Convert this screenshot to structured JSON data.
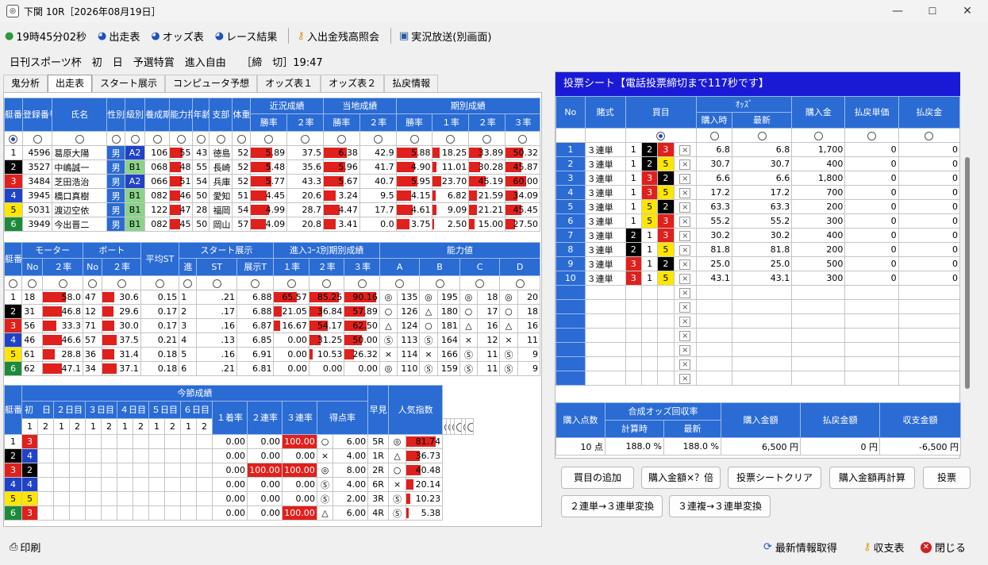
{
  "window": {
    "title": "下関 10R［2026年08月19日］"
  },
  "toolbar": {
    "clock": "19時45分02秒",
    "items": [
      "出走表",
      "オッズ表",
      "レース結果",
      "入出金残高照会",
      "実況放送(別画面)"
    ]
  },
  "race": {
    "info": "日刊スポーツ杯　初　日　予選特賞　進入自由　　［締　切］19:47"
  },
  "tabs": [
    "鬼分析",
    "出走表",
    "スタート展示",
    "コンピュータ予想",
    "オッズ表１",
    "オッズ表２",
    "払戻情報"
  ],
  "table1": {
    "headers": {
      "boat": "艇番",
      "reg": "登録番号",
      "name": "氏名",
      "gender": "性別",
      "class": "級別",
      "period": "養成期",
      "ability": "能力指数",
      "age": "年齢",
      "branch": "支部",
      "weight": "体重",
      "recent": "近況成績",
      "local": "当地成績",
      "term": "期別成績",
      "win": "勝率",
      "r2": "２率",
      "r1": "１率",
      "r3": "３率"
    },
    "rows": [
      {
        "b": "1",
        "reg": "4596",
        "name": "葛原大陽",
        "g": "男",
        "cls": "A2",
        "per": "106",
        "abl": "55",
        "age": "43",
        "br": "徳島",
        "wt": "52",
        "rw": "5.89",
        "rr2": "37.5",
        "lw": "6.38",
        "lr2": "42.9",
        "tw": "5.88",
        "tr1": "18.25",
        "tr2": "33.89",
        "tr3": "50.32"
      },
      {
        "b": "2",
        "reg": "3527",
        "name": "中嶋誠一",
        "g": "男",
        "cls": "B1",
        "per": "068",
        "abl": "48",
        "age": "55",
        "br": "長崎",
        "wt": "52",
        "rw": "5.48",
        "rr2": "35.6",
        "lw": "5.96",
        "lr2": "41.7",
        "tw": "4.90",
        "tr1": "11.01",
        "tr2": "30.28",
        "tr3": "45.87"
      },
      {
        "b": "3",
        "reg": "3484",
        "name": "芝田浩治",
        "g": "男",
        "cls": "A2",
        "per": "066",
        "abl": "51",
        "age": "54",
        "br": "兵庫",
        "wt": "52",
        "rw": "5.77",
        "rr2": "43.3",
        "lw": "5.67",
        "lr2": "40.7",
        "tw": "5.95",
        "tr1": "23.70",
        "tr2": "45.19",
        "tr3": "60.00"
      },
      {
        "b": "4",
        "reg": "3945",
        "name": "橋口真樹",
        "g": "男",
        "cls": "B1",
        "per": "082",
        "abl": "46",
        "age": "50",
        "br": "愛知",
        "wt": "51",
        "rw": "4.45",
        "rr2": "20.6",
        "lw": "3.24",
        "lr2": "9.5",
        "tw": "4.15",
        "tr1": "6.82",
        "tr2": "21.59",
        "tr3": "34.09"
      },
      {
        "b": "5",
        "reg": "5031",
        "name": "渡辺空依",
        "g": "男",
        "cls": "B1",
        "per": "122",
        "abl": "47",
        "age": "28",
        "br": "福岡",
        "wt": "54",
        "rw": "4.99",
        "rr2": "28.7",
        "lw": "4.47",
        "lr2": "17.7",
        "tw": "4.61",
        "tr1": "9.09",
        "tr2": "21.21",
        "tr3": "45.45"
      },
      {
        "b": "6",
        "reg": "3949",
        "name": "今出晋二",
        "g": "男",
        "cls": "B1",
        "per": "082",
        "abl": "45",
        "age": "50",
        "br": "岡山",
        "wt": "57",
        "rw": "4.09",
        "rr2": "20.8",
        "lw": "3.41",
        "lr2": "0.0",
        "tw": "3.75",
        "tr1": "2.50",
        "tr2": "15.00",
        "tr3": "27.50"
      }
    ]
  },
  "table2": {
    "headers": {
      "boat": "艇番",
      "motor": "モーター",
      "boatm": "ボート",
      "no": "No",
      "r2": "２率",
      "avgst": "平均ST",
      "start": "スタート展示",
      "course": "進",
      "st": "ST",
      "exh": "展示T",
      "entry": "進入ｺｰｽ別期別成績",
      "r1": "１率",
      "r3": "３率",
      "ability": "能力値",
      "A": "A",
      "B": "B",
      "C": "C",
      "D": "D"
    },
    "rows": [
      {
        "b": "1",
        "mn": "18",
        "m2": "58.0",
        "bn": "47",
        "b2": "30.6",
        "ast": "0.15",
        "c": "1",
        "st": ".21",
        "ex": "6.88",
        "e1": "65.57",
        "e2": "85.25",
        "e3": "90.16",
        "am": "◎",
        "av": "135",
        "bm": "◎",
        "bv": "195",
        "cm": "◎",
        "cv": "18",
        "dm": "◎",
        "dv": "20"
      },
      {
        "b": "2",
        "mn": "31",
        "m2": "46.8",
        "bn": "12",
        "b2": "29.6",
        "ast": "0.17",
        "c": "2",
        "st": ".17",
        "ex": "6.88",
        "e1": "21.05",
        "e2": "36.84",
        "e3": "57.89",
        "am": "○",
        "av": "126",
        "bm": "△",
        "bv": "180",
        "cm": "○",
        "cv": "17",
        "dm": "○",
        "dv": "18"
      },
      {
        "b": "3",
        "mn": "56",
        "m2": "33.3",
        "bn": "71",
        "b2": "30.0",
        "ast": "0.17",
        "c": "3",
        "st": ".16",
        "ex": "6.87",
        "e1": "16.67",
        "e2": "54.17",
        "e3": "62.50",
        "am": "△",
        "av": "124",
        "bm": "○",
        "bv": "181",
        "cm": "△",
        "cv": "16",
        "dm": "△",
        "dv": "16"
      },
      {
        "b": "4",
        "mn": "46",
        "m2": "46.6",
        "bn": "57",
        "b2": "37.5",
        "ast": "0.21",
        "c": "4",
        "st": ".13",
        "ex": "6.85",
        "e1": "0.00",
        "e2": "31.25",
        "e3": "50.00",
        "am": "Ⓢ",
        "av": "113",
        "bm": "Ⓢ",
        "bv": "164",
        "cm": "×",
        "cv": "12",
        "dm": "×",
        "dv": "11"
      },
      {
        "b": "5",
        "mn": "61",
        "m2": "28.8",
        "bn": "36",
        "b2": "31.4",
        "ast": "0.18",
        "c": "5",
        "st": ".16",
        "ex": "6.91",
        "e1": "0.00",
        "e2": "10.53",
        "e3": "26.32",
        "am": "×",
        "av": "114",
        "bm": "×",
        "bv": "166",
        "cm": "Ⓢ",
        "cv": "11",
        "dm": "Ⓢ",
        "dv": "9"
      },
      {
        "b": "6",
        "mn": "62",
        "m2": "47.1",
        "bn": "34",
        "b2": "37.1",
        "ast": "0.18",
        "c": "6",
        "st": ".21",
        "ex": "6.81",
        "e1": "0.00",
        "e2": "0.00",
        "e3": "0.00",
        "am": "◎",
        "av": "110",
        "bm": "Ⓢ",
        "bv": "159",
        "cm": "Ⓢ",
        "cv": "11",
        "dm": "Ⓢ",
        "dv": "9"
      }
    ]
  },
  "table3": {
    "headers": {
      "boat": "艇番",
      "series": "今節成績",
      "days": [
        "初　日",
        "２日目",
        "３日目",
        "４日目",
        "５日目",
        "６日目"
      ],
      "races": [
        "1",
        "2",
        "1",
        "2",
        "1",
        "2",
        "1",
        "2",
        "1",
        "2",
        "1",
        "2"
      ],
      "p1": "１着率",
      "p2": "２連率",
      "p3": "３連率",
      "score": "得点率",
      "early": "早見",
      "pop": "人気指数"
    },
    "rows": [
      {
        "b": "1",
        "d1": "3",
        "p1": "0.00",
        "p2": "0.00",
        "p3": "100.00",
        "sm": "○",
        "sc": "6.00",
        "e": "5R",
        "pm": "◎",
        "pv": "81.74"
      },
      {
        "b": "2",
        "d1": "4",
        "p1": "0.00",
        "p2": "0.00",
        "p3": "0.00",
        "sm": "×",
        "sc": "4.00",
        "e": "1R",
        "pm": "△",
        "pv": "36.73"
      },
      {
        "b": "3",
        "d1": "2",
        "p1": "0.00",
        "p2": "100.00",
        "p3": "100.00",
        "sm": "◎",
        "sc": "8.00",
        "e": "2R",
        "pm": "○",
        "pv": "40.48"
      },
      {
        "b": "4",
        "d1": "4",
        "p1": "0.00",
        "p2": "0.00",
        "p3": "0.00",
        "sm": "Ⓢ",
        "sc": "4.00",
        "e": "6R",
        "pm": "×",
        "pv": "20.14"
      },
      {
        "b": "5",
        "d1": "5",
        "p1": "0.00",
        "p2": "0.00",
        "p3": "0.00",
        "sm": "Ⓢ",
        "sc": "2.00",
        "e": "3R",
        "pm": "Ⓢ",
        "pv": "10.23"
      },
      {
        "b": "6",
        "d1": "3",
        "p1": "0.00",
        "p2": "0.00",
        "p3": "100.00",
        "sm": "△",
        "sc": "6.00",
        "e": "4R",
        "pm": "Ⓢ",
        "pv": "5.38"
      }
    ]
  },
  "vote": {
    "title": "投票シート【電話投票締切まで117秒です】",
    "headers": {
      "no": "No",
      "type": "賭式",
      "buy": "買目",
      "odds": "ｵｯｽﾞ",
      "at_buy": "購入時",
      "latest": "最新",
      "amount": "購入金",
      "pay_unit": "払戻単価",
      "payout": "払戻金"
    },
    "rows": [
      {
        "no": "1",
        "type": "３連単",
        "a": "1",
        "b": "2",
        "c": "3",
        "ob": "6.8",
        "ol": "6.8",
        "amt": "1,700",
        "pu": "0",
        "pay": "0"
      },
      {
        "no": "2",
        "type": "３連単",
        "a": "1",
        "b": "2",
        "c": "5",
        "ob": "30.7",
        "ol": "30.7",
        "amt": "400",
        "pu": "0",
        "pay": "0"
      },
      {
        "no": "3",
        "type": "３連単",
        "a": "1",
        "b": "3",
        "c": "2",
        "ob": "6.6",
        "ol": "6.6",
        "amt": "1,800",
        "pu": "0",
        "pay": "0"
      },
      {
        "no": "4",
        "type": "３連単",
        "a": "1",
        "b": "3",
        "c": "5",
        "ob": "17.2",
        "ol": "17.2",
        "amt": "700",
        "pu": "0",
        "pay": "0"
      },
      {
        "no": "5",
        "type": "３連単",
        "a": "1",
        "b": "5",
        "c": "2",
        "ob": "63.3",
        "ol": "63.3",
        "amt": "200",
        "pu": "0",
        "pay": "0"
      },
      {
        "no": "6",
        "type": "３連単",
        "a": "1",
        "b": "5",
        "c": "3",
        "ob": "55.2",
        "ol": "55.2",
        "amt": "300",
        "pu": "0",
        "pay": "0"
      },
      {
        "no": "7",
        "type": "３連単",
        "a": "2",
        "b": "1",
        "c": "3",
        "ob": "30.2",
        "ol": "30.2",
        "amt": "400",
        "pu": "0",
        "pay": "0"
      },
      {
        "no": "8",
        "type": "３連単",
        "a": "2",
        "b": "1",
        "c": "5",
        "ob": "81.8",
        "ol": "81.8",
        "amt": "200",
        "pu": "0",
        "pay": "0"
      },
      {
        "no": "9",
        "type": "３連単",
        "a": "3",
        "b": "1",
        "c": "2",
        "ob": "25.0",
        "ol": "25.0",
        "amt": "500",
        "pu": "0",
        "pay": "0"
      },
      {
        "no": "10",
        "type": "３連単",
        "a": "3",
        "b": "1",
        "c": "5",
        "ob": "43.1",
        "ol": "43.1",
        "amt": "300",
        "pu": "0",
        "pay": "0"
      }
    ],
    "x_mark": "×",
    "summary": {
      "h_points": "購入点数",
      "h_rate": "合成オッズ回収率",
      "h_calc": "計算時",
      "h_latest": "最新",
      "h_amount": "購入金額",
      "h_payout": "払戻金額",
      "h_balance": "収支金額",
      "points": "10 点",
      "calc": "188.0 %",
      "latest": "188.0 %",
      "amount": "6,500 円",
      "payout": "0 円",
      "balance": "-6,500 円"
    }
  },
  "buttons": {
    "add": "買目の追加",
    "mult": "購入金額×？倍",
    "clear": "投票シートクリア",
    "recalc": "購入金額再計算",
    "vote": "投票",
    "conv2": "２連単→３連単変換",
    "conv3": "３連複→３連単変換"
  },
  "footer": {
    "print": "印刷",
    "refresh": "最新情報取得",
    "ledger": "収支表",
    "close": "閉じる"
  },
  "colors": {
    "header_blue": "#2a6bd4",
    "bar_red": "#e0201c",
    "vote_title": "#1a1ad6"
  }
}
